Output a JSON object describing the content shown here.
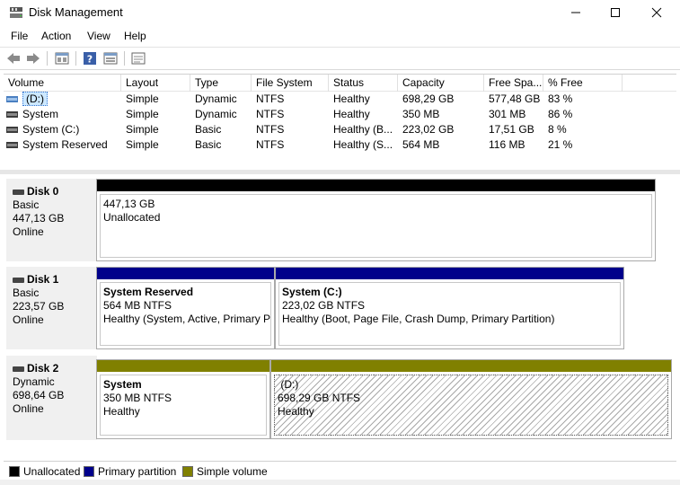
{
  "window": {
    "title": "Disk Management"
  },
  "menu": [
    "File",
    "Action",
    "View",
    "Help"
  ],
  "toolbar": {
    "icons": [
      "back-arrow-icon",
      "forward-arrow-icon",
      "properties-icon",
      "help-icon",
      "show-hide-console-icon",
      "list-icon"
    ]
  },
  "volume_list": {
    "columns": [
      "Volume",
      "Layout",
      "Type",
      "File System",
      "Status",
      "Capacity",
      "Free Spa...",
      "% Free"
    ],
    "rows": [
      [
        "(D:)",
        "Simple",
        "Dynamic",
        "NTFS",
        "Healthy",
        "698,29 GB",
        "577,48 GB",
        "83 %"
      ],
      [
        "System",
        "Simple",
        "Dynamic",
        "NTFS",
        "Healthy",
        "350 MB",
        "301 MB",
        "86 %"
      ],
      [
        "System (C:)",
        "Simple",
        "Basic",
        "NTFS",
        "Healthy (B...",
        "223,02 GB",
        "17,51 GB",
        "8 %"
      ],
      [
        "System Reserved",
        "Simple",
        "Basic",
        "NTFS",
        "Healthy (S...",
        "564 MB",
        "116 MB",
        "21 %"
      ]
    ]
  },
  "disks": [
    {
      "name": "Disk 0",
      "type": "Basic",
      "size": "447,13 GB",
      "state": "Online",
      "partitions": [
        {
          "title": "",
          "line1": "447,13 GB",
          "line2": "Unallocated"
        }
      ]
    },
    {
      "name": "Disk 1",
      "type": "Basic",
      "size": "223,57 GB",
      "state": "Online",
      "partitions": [
        {
          "title": "System Reserved",
          "line1": "564 MB NTFS",
          "line2": "Healthy (System, Active, Primary P"
        },
        {
          "title": "System  (C:)",
          "line1": "223,02 GB NTFS",
          "line2": "Healthy (Boot, Page File, Crash Dump, Primary Partition)"
        }
      ]
    },
    {
      "name": "Disk 2",
      "type": "Dynamic",
      "size": "698,64 GB",
      "state": "Online",
      "partitions": [
        {
          "title": "System",
          "line1": "350 MB NTFS",
          "line2": "Healthy"
        },
        {
          "title": "(D:)",
          "line1": "698,29 GB NTFS",
          "line2": "Healthy"
        }
      ]
    }
  ],
  "legend": [
    {
      "label": "Unallocated",
      "color": "#000000"
    },
    {
      "label": "Primary partition",
      "color": "#00008b"
    },
    {
      "label": "Simple volume",
      "color": "#808000"
    }
  ],
  "colors": {
    "unallocated": "#000000",
    "primary": "#00008b",
    "simple": "#808000",
    "selection": "#cce8ff"
  }
}
